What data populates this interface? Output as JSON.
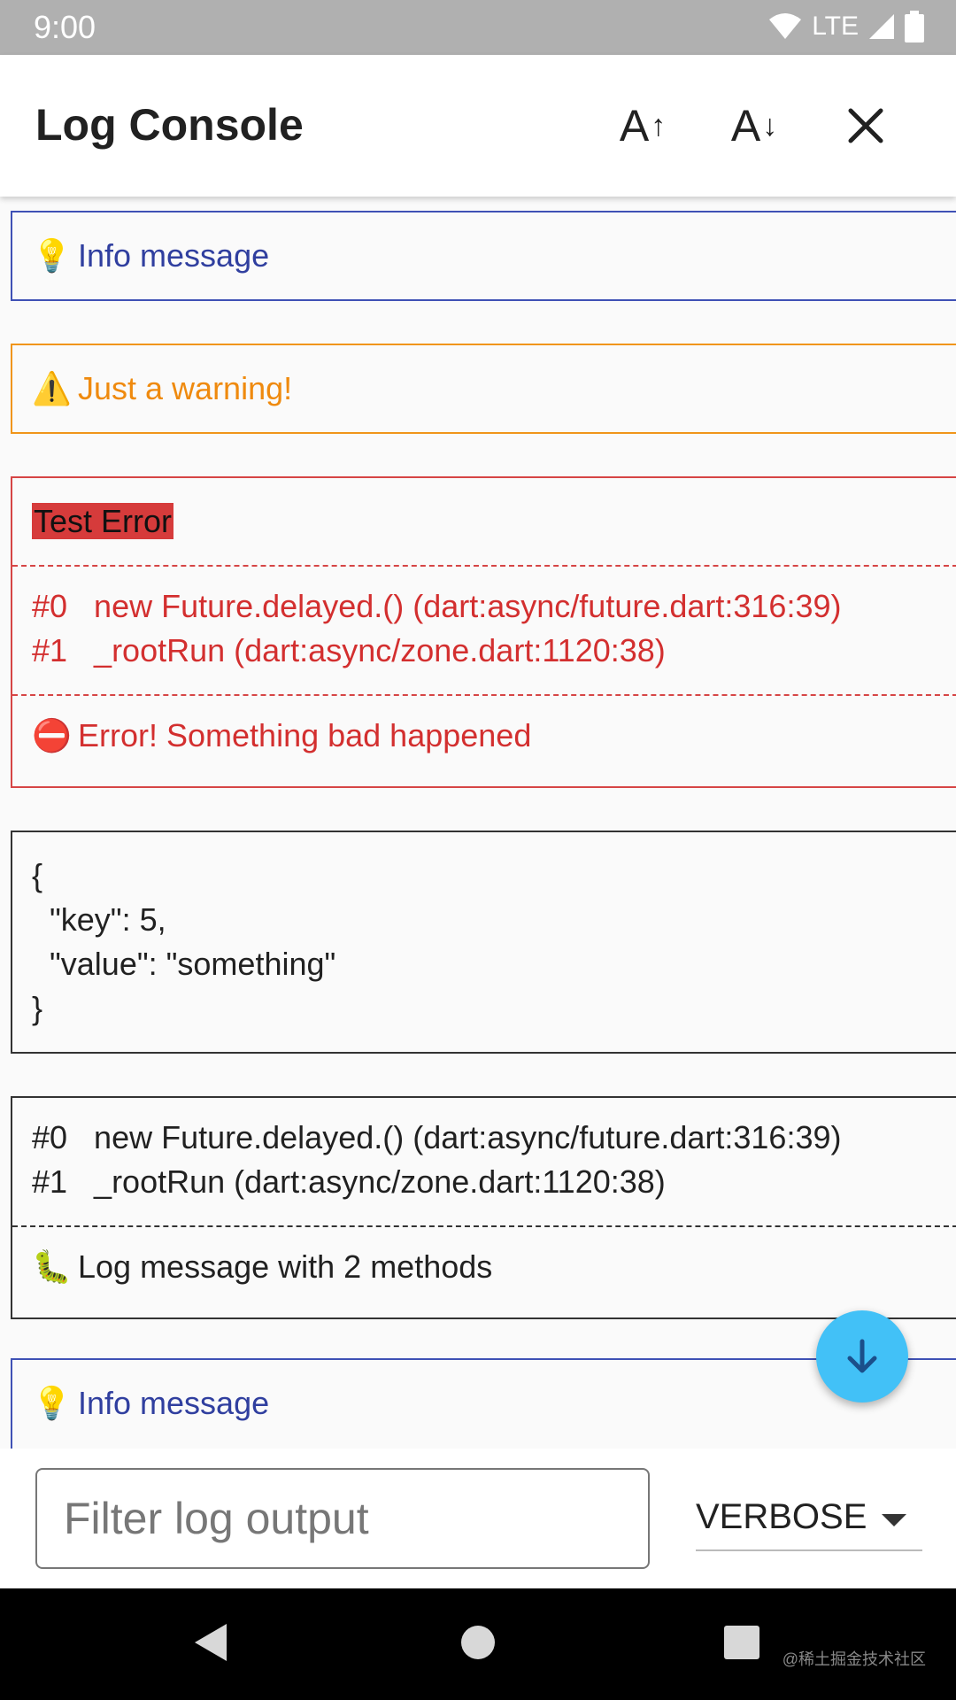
{
  "status_bar": {
    "time": "9:00",
    "network": "LTE"
  },
  "app_bar": {
    "title": "Log Console",
    "increase_font_label": "A",
    "decrease_font_label": "A"
  },
  "logs": {
    "info1": {
      "emoji": "💡",
      "message": "Info message"
    },
    "warning": {
      "emoji": "⚠️",
      "message": "Just a warning!"
    },
    "error": {
      "tag": "Test Error",
      "trace1": "#0   new Future.delayed.() (dart:async/future.dart:316:39)",
      "trace2": "#1   _rootRun (dart:async/zone.dart:1120:38)",
      "emoji": "⛔",
      "message": "Error! Something bad happened"
    },
    "json": {
      "line1": "{",
      "line2": "  \"key\": 5,",
      "line3": "  \"value\": \"something\"",
      "line4": "}"
    },
    "debug": {
      "trace1": "#0   new Future.delayed.() (dart:async/future.dart:316:39)",
      "trace2": "#1   _rootRun (dart:async/zone.dart:1120:38)",
      "emoji": "🐛",
      "message": "Log message with 2 methods"
    },
    "info2": {
      "emoji": "💡",
      "message": "Info message"
    }
  },
  "filter": {
    "placeholder": "Filter log output",
    "value": ""
  },
  "level_select": {
    "selected": "VERBOSE"
  },
  "watermark": "@稀土掘金技术社区"
}
